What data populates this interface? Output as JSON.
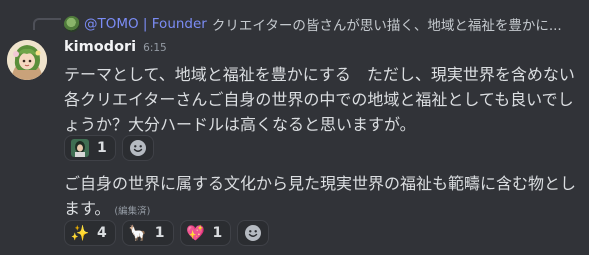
{
  "reply": {
    "author": "@TOMO | Founder",
    "preview": "クリエイターの皆さんが思い描く、地域と福祉を豊かに..."
  },
  "message": {
    "username": "kimodori",
    "timestamp": "6:15",
    "text_1": "テーマとして、地域と福祉を豊かにする　ただし、現実世界を含めない各クリエイターさんご自身の世界の中での地域と福祉としても良いでしょうか？大分ハードルは高くなると思いますが。",
    "reactions_1": [
      {
        "icon": "avatar-photo-emoji",
        "count": "1"
      }
    ],
    "text_2": "ご自身の世界に属する文化から見た現実世界の福祉も範疇に含む物とします。",
    "edited_label": "(編集済)",
    "reactions_2": [
      {
        "icon": "sparkles-emoji",
        "glyph": "✨",
        "count": "4"
      },
      {
        "icon": "llama-emoji",
        "glyph": "🦙",
        "count": "1"
      },
      {
        "icon": "sparkling-heart-emoji",
        "glyph": "💖",
        "count": "1"
      }
    ]
  },
  "colors": {
    "background": "#313338",
    "reply_author": "#7b8cf5",
    "username": "#f2f3f5",
    "muted": "#949ba4",
    "reaction_bg": "#2b2d31"
  }
}
